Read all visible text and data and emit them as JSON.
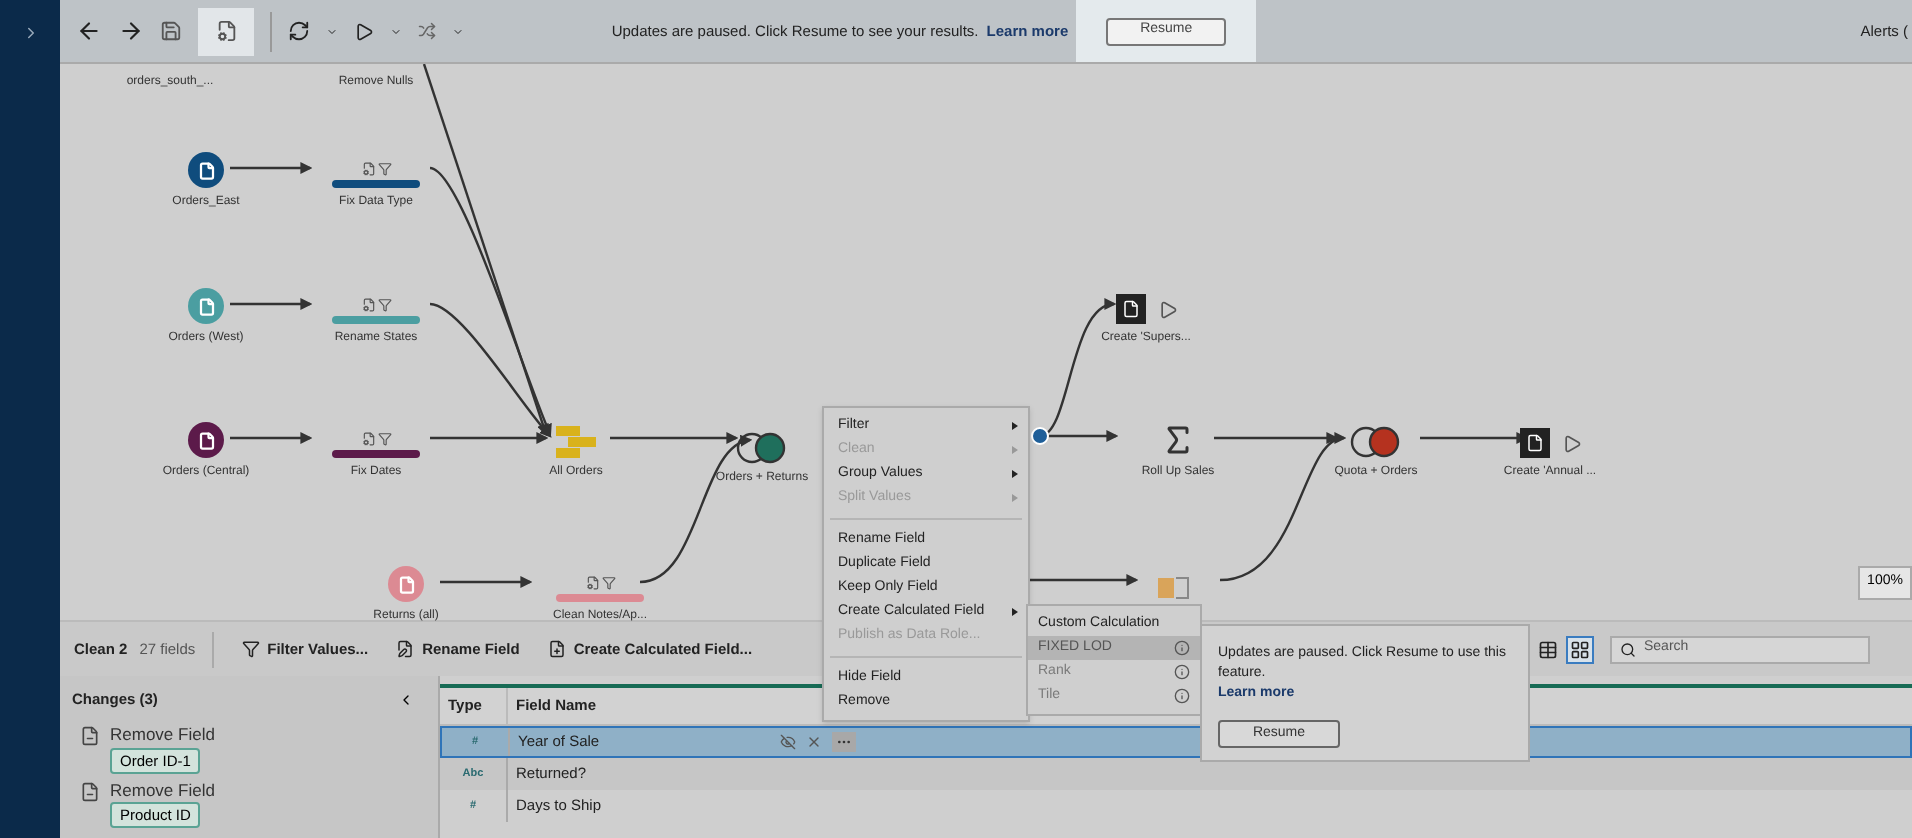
{
  "toolbar": {
    "message": "Updates are paused. Click Resume to see your results.",
    "link": "Learn more",
    "resume": "Resume",
    "alerts": "Alerts ("
  },
  "flow": {
    "nodes": [
      {
        "kind": "offscreen",
        "label": "orders_south_..."
      },
      {
        "kind": "offscreen",
        "label": "Remove Nulls"
      },
      {
        "kind": "input",
        "label": "Orders_East",
        "color": "#0f4c7d"
      },
      {
        "kind": "clean",
        "label": "Fix Data Type",
        "color": "#0f4c7d"
      },
      {
        "kind": "input",
        "label": "Orders (West)",
        "color": "#4b9ea1"
      },
      {
        "kind": "clean",
        "label": "Rename States",
        "color": "#4b9ea1"
      },
      {
        "kind": "input",
        "label": "Orders (Central)",
        "color": "#5c1a4a"
      },
      {
        "kind": "clean",
        "label": "Fix Dates",
        "color": "#5c1a4a"
      },
      {
        "kind": "union",
        "label": "All Orders"
      },
      {
        "kind": "join",
        "label": "Orders + Returns",
        "color": "#1f6f5c"
      },
      {
        "kind": "input",
        "label": "Returns (all)",
        "color": "#dc8a93"
      },
      {
        "kind": "clean",
        "label": "Clean Notes/Ap...",
        "color": "#dc8a93"
      },
      {
        "kind": "output",
        "label": "Create 'Supers..."
      },
      {
        "kind": "aggregate",
        "label": "Roll Up Sales"
      },
      {
        "kind": "join",
        "label": "Quota + Orders",
        "color": "#b5321f"
      },
      {
        "kind": "output",
        "label": "Create 'Annual ..."
      },
      {
        "kind": "pivot"
      }
    ],
    "zoom": "100%"
  },
  "context_menu": {
    "items": [
      {
        "kind": "item",
        "label": "Filter",
        "disabled": false,
        "submenu": true
      },
      {
        "kind": "item",
        "label": "Clean",
        "disabled": true,
        "submenu": true
      },
      {
        "kind": "item",
        "label": "Group Values",
        "disabled": false,
        "submenu": true
      },
      {
        "kind": "item",
        "label": "Split Values",
        "disabled": true,
        "submenu": true
      },
      {
        "kind": "separator"
      },
      {
        "kind": "item",
        "label": "Rename Field",
        "disabled": false,
        "submenu": false
      },
      {
        "kind": "item",
        "label": "Duplicate Field",
        "disabled": false,
        "submenu": false
      },
      {
        "kind": "item",
        "label": "Keep Only Field",
        "disabled": false,
        "submenu": false
      },
      {
        "kind": "item",
        "label": "Create Calculated Field",
        "disabled": false,
        "submenu": true
      },
      {
        "kind": "item",
        "label": "Publish as Data Role...",
        "disabled": true,
        "submenu": false
      },
      {
        "kind": "separator"
      },
      {
        "kind": "item",
        "label": "Hide Field",
        "disabled": false,
        "submenu": false
      },
      {
        "kind": "item",
        "label": "Remove",
        "disabled": false,
        "submenu": false
      }
    ]
  },
  "submenu": {
    "items": [
      {
        "label": "Custom Calculation",
        "disabled": false,
        "selected": false,
        "info": false
      },
      {
        "label": "FIXED LOD",
        "disabled": true,
        "selected": true,
        "info": true
      },
      {
        "label": "Rank",
        "disabled": true,
        "selected": false,
        "info": true
      },
      {
        "label": "Tile",
        "disabled": true,
        "selected": false,
        "info": true
      }
    ]
  },
  "tooltip": {
    "text": "Updates are paused. Click Resume to use this feature.",
    "link": "Learn more",
    "button": "Resume"
  },
  "step_bar": {
    "name": "Clean 2",
    "count": "27 fields",
    "actions": [
      "Filter Values...",
      "Rename Field",
      "Create Calculated Field..."
    ],
    "views": [
      {
        "selected": false
      },
      {
        "selected": true
      }
    ],
    "search_placeholder": "Search"
  },
  "changes": {
    "title": "Changes (3)",
    "items": [
      {
        "action": "Remove Field",
        "field": "Order ID-1"
      },
      {
        "action": "Remove Field",
        "field": "Product ID"
      }
    ]
  },
  "table": {
    "columns": [
      "Type",
      "Field Name"
    ],
    "rows": [
      {
        "type": "#",
        "name": "Year of Sale",
        "selected": true
      },
      {
        "type": "Abc",
        "name": "Returned?",
        "selected": false
      },
      {
        "type": "#",
        "name": "Days to Ship",
        "selected": false
      }
    ]
  }
}
